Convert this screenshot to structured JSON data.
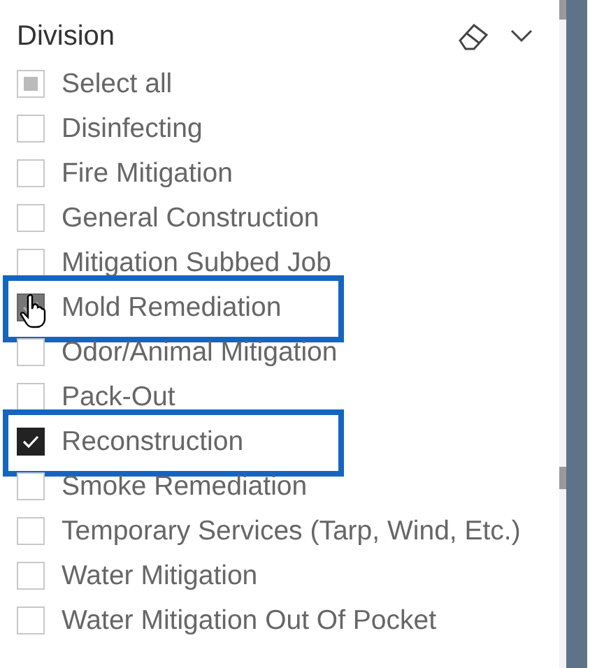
{
  "slicer": {
    "title": "Division",
    "items": [
      {
        "label": "Select all",
        "checked": false,
        "indeterminate": true,
        "highlighted": false,
        "hovered": false
      },
      {
        "label": "Disinfecting",
        "checked": false,
        "indeterminate": false,
        "highlighted": false,
        "hovered": false
      },
      {
        "label": "Fire Mitigation",
        "checked": false,
        "indeterminate": false,
        "highlighted": false,
        "hovered": false
      },
      {
        "label": "General Construction",
        "checked": false,
        "indeterminate": false,
        "highlighted": false,
        "hovered": false
      },
      {
        "label": "Mitigation Subbed Job",
        "checked": false,
        "indeterminate": false,
        "highlighted": false,
        "hovered": false
      },
      {
        "label": "Mold Remediation",
        "checked": true,
        "indeterminate": false,
        "highlighted": true,
        "hovered": true
      },
      {
        "label": "Odor/Animal Mitigation",
        "checked": false,
        "indeterminate": false,
        "highlighted": false,
        "hovered": false
      },
      {
        "label": "Pack-Out",
        "checked": false,
        "indeterminate": false,
        "highlighted": false,
        "hovered": false
      },
      {
        "label": "Reconstruction",
        "checked": true,
        "indeterminate": false,
        "highlighted": true,
        "hovered": false
      },
      {
        "label": "Smoke Remediation",
        "checked": false,
        "indeterminate": false,
        "highlighted": false,
        "hovered": false
      },
      {
        "label": "Temporary Services (Tarp, Wind, Etc.)",
        "checked": false,
        "indeterminate": false,
        "highlighted": false,
        "hovered": false
      },
      {
        "label": "Water Mitigation",
        "checked": false,
        "indeterminate": false,
        "highlighted": false,
        "hovered": false
      },
      {
        "label": "Water Mitigation Out Of Pocket",
        "checked": false,
        "indeterminate": false,
        "highlighted": false,
        "hovered": false
      }
    ]
  }
}
